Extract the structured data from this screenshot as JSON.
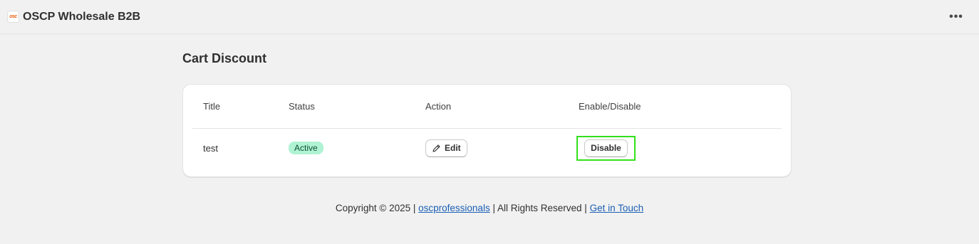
{
  "app": {
    "logo_text": "osc",
    "title": "OSCP Wholesale B2B",
    "menu_icon": "ellipsis-icon",
    "menu_label": "•••"
  },
  "page": {
    "title": "Cart Discount"
  },
  "table": {
    "headers": [
      "Title",
      "Status",
      "Action",
      "Enable/Disable"
    ],
    "rows": [
      {
        "title": "test",
        "status": "Active",
        "action_label": "Edit",
        "toggle_label": "Disable"
      }
    ]
  },
  "footer": {
    "copyright": "Copyright © 2025 |",
    "company_link": "oscprofessionals",
    "rights": "| All Rights Reserved |",
    "contact_link": "Get in Touch"
  },
  "colors": {
    "status_active_bg": "#aff2d4",
    "highlight": "#33e01a",
    "link": "#1a5fb4"
  }
}
